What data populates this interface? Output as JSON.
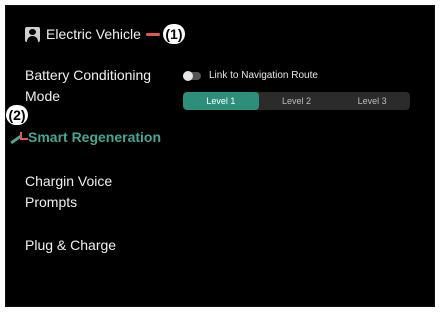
{
  "header": {
    "title": "Electric Vehicle",
    "callout_1": "(1)"
  },
  "menu": {
    "items": [
      {
        "label_line1": "Battery Conditioning",
        "label_line2": "Mode"
      },
      {
        "label": "Smart Regeneration",
        "active": true
      },
      {
        "label_line1": "Chargin Voice",
        "label_line2": "Prompts"
      },
      {
        "label": "Plug & Charge"
      }
    ],
    "callout_2": "(2)"
  },
  "battery_conditioning": {
    "toggle_label": "Link to Navigation Route",
    "toggle_on": false,
    "levels": [
      "Level 1",
      "Level 2",
      "Level 3"
    ],
    "selected_level": "Level 1"
  },
  "colors": {
    "accent": "#2d8f7a",
    "active_text": "#4aa592",
    "callout_line": "#e05a5a",
    "background": "#000000"
  },
  "icons": {
    "header_icon": "user-profile-icon"
  }
}
